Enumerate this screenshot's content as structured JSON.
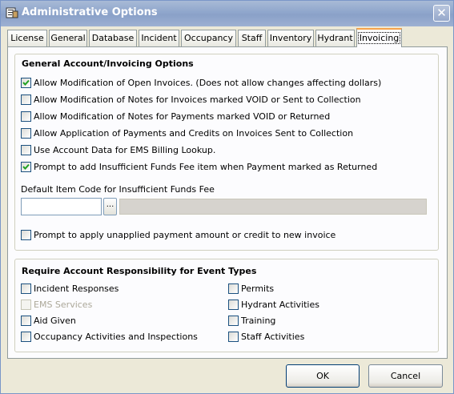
{
  "window": {
    "title": "Administrative Options",
    "close_glyph": "✕"
  },
  "tabs": [
    {
      "label": "License"
    },
    {
      "label": "General"
    },
    {
      "label": "Database"
    },
    {
      "label": "Incident"
    },
    {
      "label": "Occupancy"
    },
    {
      "label": "Staff"
    },
    {
      "label": "Inventory"
    },
    {
      "label": "Hydrant"
    },
    {
      "label": "Invoicing",
      "active": true
    }
  ],
  "general": {
    "title": "General Account/Invoicing Options",
    "options": [
      {
        "label": "Allow Modification of Open Invoices. (Does not allow changes affecting dollars)",
        "checked": true
      },
      {
        "label": "Allow Modification of Notes for Invoices marked VOID or Sent to Collection",
        "checked": false
      },
      {
        "label": "Allow Modification of Notes for Payments marked VOID or Returned",
        "checked": false
      },
      {
        "label": "Allow Application of Payments and Credits on Invoices Sent to Collection",
        "checked": false
      },
      {
        "label": "Use Account Data for EMS Billing Lookup.",
        "checked": false
      },
      {
        "label": "Prompt to add Insufficient Funds Fee item when Payment marked as Returned",
        "checked": true
      }
    ],
    "default_item_label": "Default Item Code for Insufficient Funds Fee",
    "default_item_value": "",
    "default_item_desc": "",
    "browse_label": "...",
    "prompt_unapplied": {
      "label": "Prompt to apply unapplied payment amount or credit to new invoice",
      "checked": false
    }
  },
  "responsibility": {
    "title": "Require Account Responsibility for Event Types",
    "left": [
      {
        "label": "Incident Responses",
        "checked": false
      },
      {
        "label": "EMS Services",
        "checked": false,
        "disabled": true
      },
      {
        "label": "Aid Given",
        "checked": false
      },
      {
        "label": "Occupancy Activities and Inspections",
        "checked": false
      }
    ],
    "right": [
      {
        "label": "Permits",
        "checked": false
      },
      {
        "label": "Hydrant Activities",
        "checked": false
      },
      {
        "label": "Training",
        "checked": false
      },
      {
        "label": "Staff Activities",
        "checked": false
      }
    ]
  },
  "buttons": {
    "ok": "OK",
    "cancel": "Cancel"
  }
}
